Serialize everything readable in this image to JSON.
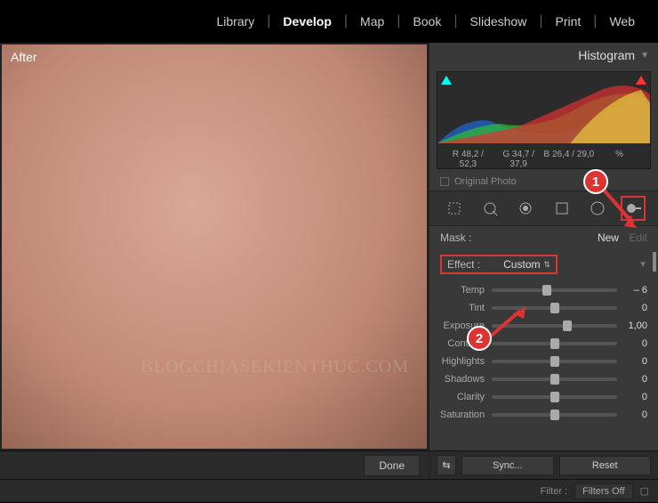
{
  "modules": {
    "library": "Library",
    "develop": "Develop",
    "map": "Map",
    "book": "Book",
    "slideshow": "Slideshow",
    "print": "Print",
    "web": "Web",
    "active": "develop"
  },
  "after_label": "After",
  "watermark": "BLOGCHIASEKIENTHUC.COM",
  "done_button": "Done",
  "histogram": {
    "title": "Histogram",
    "readout": {
      "r": "R  48,2 / 52,3",
      "g": "G  34,7 / 37,9",
      "b": "B  26,4 / 29,0",
      "pct": "%"
    },
    "original_photo": "Original Photo"
  },
  "tools": {
    "crop": "crop-tool",
    "spot": "spot-removal",
    "redeye": "redeye-tool",
    "graduated": "graduated-filter",
    "radial": "radial-filter",
    "brush": "adjustment-brush"
  },
  "mask": {
    "label": "Mask :",
    "new": "New",
    "edit": "Edit"
  },
  "effect": {
    "label": "Effect :",
    "value": "Custom"
  },
  "sliders": [
    {
      "label": "Temp",
      "value": "– 6",
      "pos": 44
    },
    {
      "label": "Tint",
      "value": "0",
      "pos": 50
    },
    {
      "label": "Exposure",
      "value": "1,00",
      "pos": 60
    },
    {
      "label": "Contrast",
      "value": "0",
      "pos": 50
    },
    {
      "label": "Highlights",
      "value": "0",
      "pos": 50
    },
    {
      "label": "Shadows",
      "value": "0",
      "pos": 50
    },
    {
      "label": "Clarity",
      "value": "0",
      "pos": 50
    },
    {
      "label": "Saturation",
      "value": "0",
      "pos": 50
    }
  ],
  "buttons": {
    "switch": "⇆",
    "sync": "Sync...",
    "reset": "Reset"
  },
  "filter": {
    "label": "Filter :",
    "value": "Filters Off"
  },
  "callouts": {
    "one": "1",
    "two": "2"
  }
}
